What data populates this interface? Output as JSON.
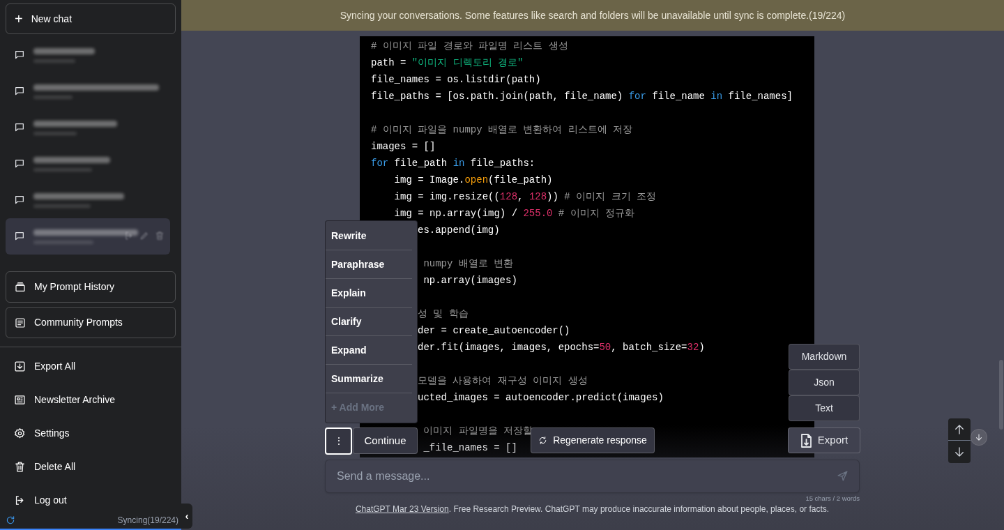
{
  "banner": {
    "text": "Syncing your conversations. Some features like search and folders will be unavailable until sync is complete.(19/224)"
  },
  "sidebar": {
    "new_chat": {
      "icon": "+",
      "label": "New chat"
    },
    "conversations": [
      {
        "selected": false
      },
      {
        "selected": false
      },
      {
        "selected": false
      },
      {
        "selected": false
      },
      {
        "selected": false
      },
      {
        "selected": true
      }
    ],
    "prompt_buttons": [
      "My Prompt History",
      "Community Prompts"
    ],
    "menu": [
      "Export All",
      "Newsletter Archive",
      "Settings",
      "Delete All",
      "Log out"
    ],
    "sync_status": "Syncing(19/224)",
    "collapse": "‹"
  },
  "code": [
    {
      "kind": "code",
      "segments": [
        {
          "kind": "comment",
          "text": "# 이미지 파일 경로와 파일명 리스트 생성"
        }
      ]
    },
    {
      "kind": "code",
      "segments": [
        {
          "kind": "plain",
          "text": "path = "
        },
        {
          "kind": "string",
          "text": "\"이미지 디렉토리 경로\""
        }
      ]
    },
    {
      "kind": "code",
      "segments": [
        {
          "kind": "plain",
          "text": "file_names = os.listdir(path)"
        }
      ]
    },
    {
      "kind": "code",
      "segments": [
        {
          "kind": "plain",
          "text": "file_paths = [os.path.join(path, file_name) "
        },
        {
          "kind": "keyword",
          "text": "for"
        },
        {
          "kind": "plain",
          "text": " file_name "
        },
        {
          "kind": "keyword",
          "text": "in"
        },
        {
          "kind": "plain",
          "text": " file_names]"
        }
      ]
    },
    {
      "kind": "blank"
    },
    {
      "kind": "code",
      "segments": [
        {
          "kind": "comment",
          "text": "# 이미지 파일을 numpy 배열로 변환하여 리스트에 저장"
        }
      ]
    },
    {
      "kind": "code",
      "segments": [
        {
          "kind": "plain",
          "text": "images = []"
        }
      ]
    },
    {
      "kind": "code",
      "segments": [
        {
          "kind": "keyword",
          "text": "for"
        },
        {
          "kind": "plain",
          "text": " file_path "
        },
        {
          "kind": "keyword",
          "text": "in"
        },
        {
          "kind": "plain",
          "text": " file_paths:"
        }
      ]
    },
    {
      "kind": "code",
      "segments": [
        {
          "kind": "plain",
          "text": "    img = Image."
        },
        {
          "kind": "func",
          "text": "open"
        },
        {
          "kind": "plain",
          "text": "(file_path)"
        }
      ]
    },
    {
      "kind": "code",
      "segments": [
        {
          "kind": "plain",
          "text": "    img = img.resize(("
        },
        {
          "kind": "number",
          "text": "128"
        },
        {
          "kind": "plain",
          "text": ", "
        },
        {
          "kind": "number",
          "text": "128"
        },
        {
          "kind": "plain",
          "text": ")) "
        },
        {
          "kind": "comment",
          "text": "# 이미지 크기 조정"
        }
      ]
    },
    {
      "kind": "code",
      "segments": [
        {
          "kind": "plain",
          "text": "    img = np.array(img) / "
        },
        {
          "kind": "number",
          "text": "255.0"
        },
        {
          "kind": "comment",
          "text": " # 이미지 정규화"
        }
      ]
    },
    {
      "kind": "covered",
      "segments": [
        {
          "kind": "plain",
          "text": "es.append(img)"
        }
      ]
    },
    {
      "kind": "blank"
    },
    {
      "kind": "covered",
      "segments": [
        {
          "kind": "comment",
          "text": " numpy 배열로 변환"
        }
      ]
    },
    {
      "kind": "covered",
      "segments": [
        {
          "kind": "plain",
          "text": " np.array(images)"
        }
      ]
    },
    {
      "kind": "blank"
    },
    {
      "kind": "covered",
      "segments": [
        {
          "kind": "comment",
          "text": "성 및 학습"
        }
      ]
    },
    {
      "kind": "covered",
      "segments": [
        {
          "kind": "plain",
          "text": "der = create_autoencoder()"
        }
      ]
    },
    {
      "kind": "covered",
      "segments": [
        {
          "kind": "plain",
          "text": "der.fit(images, images, epochs="
        },
        {
          "kind": "number",
          "text": "50"
        },
        {
          "kind": "plain",
          "text": ", batch_size="
        },
        {
          "kind": "number",
          "text": "32"
        },
        {
          "kind": "plain",
          "text": ")"
        }
      ]
    },
    {
      "kind": "blank"
    },
    {
      "kind": "covered",
      "segments": [
        {
          "kind": "comment",
          "text": "모델을 사용하여 재구성 이미지 생성"
        }
      ]
    },
    {
      "kind": "covered",
      "segments": [
        {
          "kind": "plain",
          "text": "ucted_images = autoencoder.predict(images)"
        }
      ]
    },
    {
      "kind": "blank"
    },
    {
      "kind": "covered",
      "segments": [
        {
          "kind": "comment",
          "text": " 이미지 파일명을 저장할"
        }
      ]
    },
    {
      "kind": "covered",
      "segments": [
        {
          "kind": "plain",
          "text": " _file_names = []"
        }
      ]
    }
  ],
  "action_menu": [
    {
      "label": "Rewrite",
      "kind": "action"
    },
    {
      "label": "Paraphrase",
      "kind": "action"
    },
    {
      "label": "Explain",
      "kind": "action"
    },
    {
      "label": "Clarify",
      "kind": "action"
    },
    {
      "label": "Expand",
      "kind": "action"
    },
    {
      "label": "Summarize",
      "kind": "action"
    },
    {
      "label": "+ Add More",
      "kind": "add"
    }
  ],
  "more_button": {
    "label": "⋮",
    "selected": true
  },
  "continue_button": {
    "label": "Continue"
  },
  "regenerate_button": {
    "label": "Regenerate response"
  },
  "export_menu": {
    "options": [
      "Markdown",
      "Json",
      "Text"
    ],
    "button": "Export"
  },
  "input": {
    "placeholder": "Send a message...",
    "counter": "15 chars / 2 words"
  },
  "footer": {
    "link": "ChatGPT Mar 23 Version",
    "text": ". Free Research Preview. ChatGPT may produce inaccurate information about people, places, or facts."
  }
}
